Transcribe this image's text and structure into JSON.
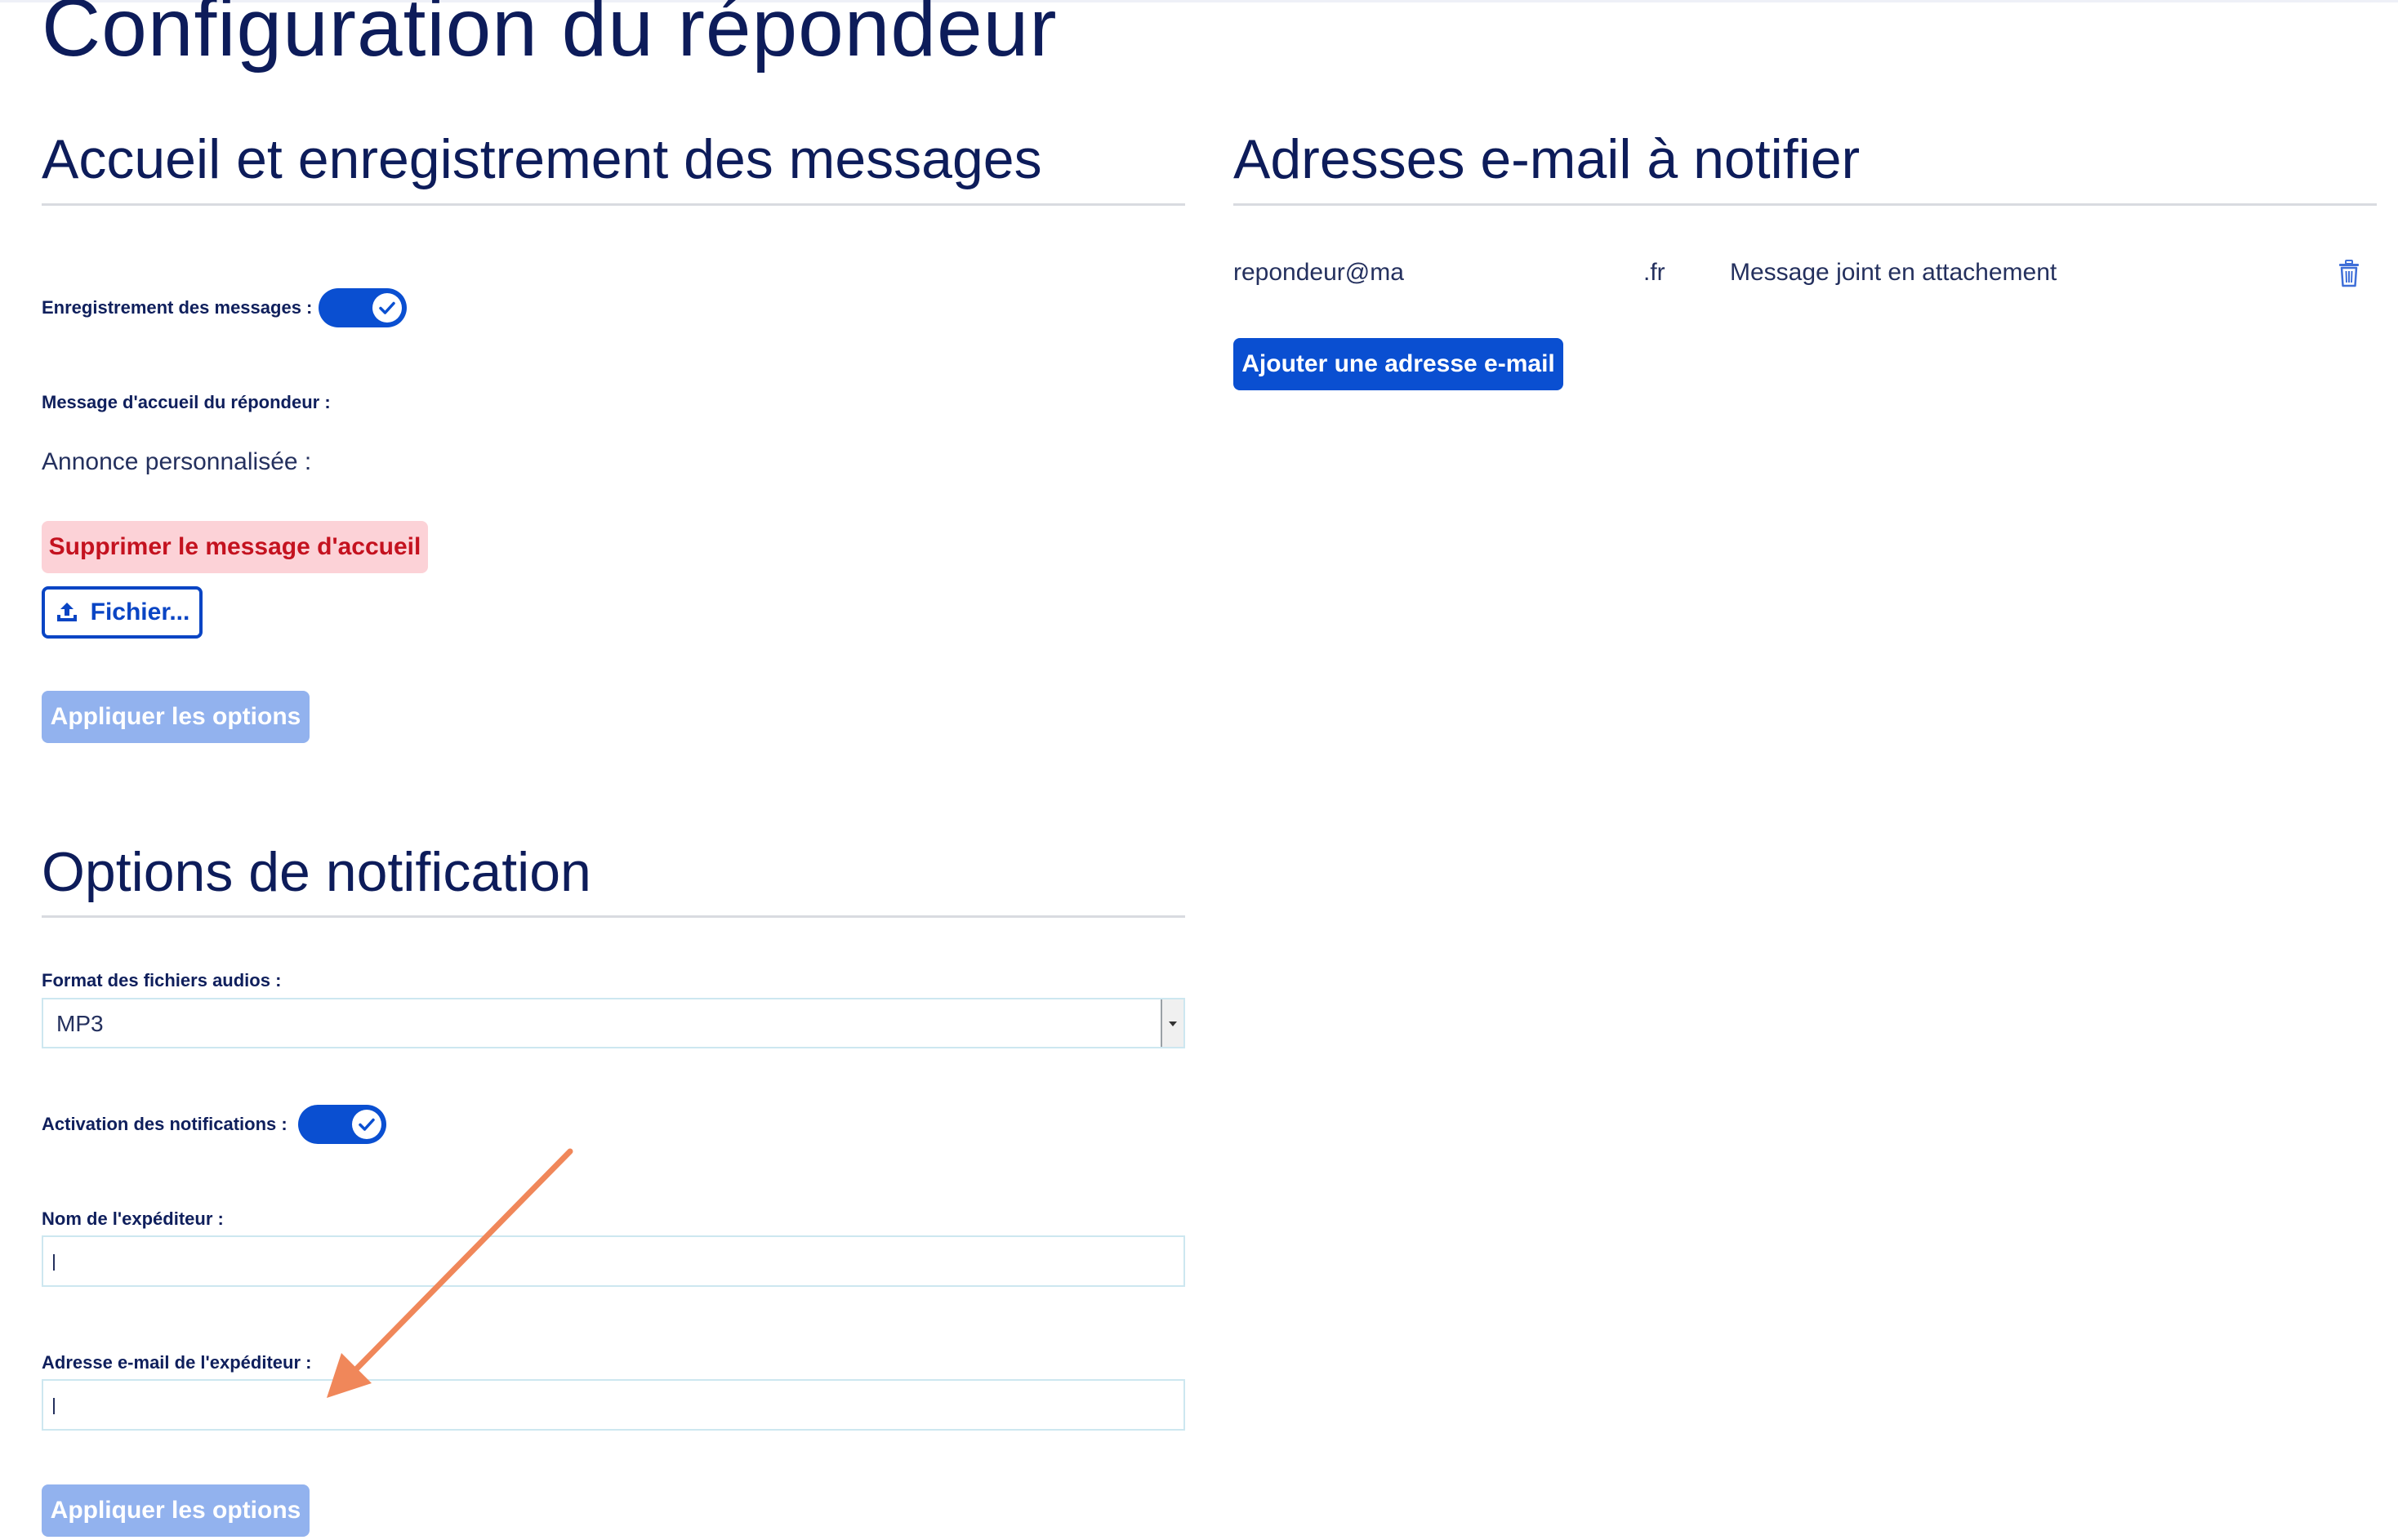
{
  "page": {
    "title": "Configuration du répondeur"
  },
  "welcome_section": {
    "title": "Accueil et enregistrement des messages",
    "recording_label": "Enregistrement des messages :",
    "recording_enabled": true,
    "welcome_message_label": "Message d'accueil du répondeur :",
    "custom_announcement_label": "Annonce personnalisée :",
    "delete_welcome_button": "Supprimer le message d'accueil",
    "file_button": "Fichier...",
    "file_icon": "upload-icon",
    "apply_button": "Appliquer les options"
  },
  "notification_section": {
    "title": "Options de notification",
    "audio_format_label": "Format des fichiers audios :",
    "audio_format_value": "MP3",
    "notifications_label": "Activation des notifications :",
    "notifications_enabled": true,
    "sender_name_label": "Nom de l'expéditeur :",
    "sender_name_value": "",
    "sender_email_label": "Adresse e-mail de l'expéditeur :",
    "sender_email_value": "",
    "apply_button": "Appliquer les options"
  },
  "email_section": {
    "title": "Adresses e-mail à notifier",
    "entries": [
      {
        "address_start": "repondeur@ma",
        "address_end": ".fr",
        "mode": "Message joint en attachement",
        "delete_icon": "trash-icon"
      }
    ],
    "add_button": "Ajouter une adresse e-mail"
  },
  "colors": {
    "primary": "#0a4fd1",
    "primary_disabled": "#92b2ee",
    "danger_text": "#c4121f",
    "danger_bg": "#fcd2d7",
    "heading": "#0d1c5a",
    "annotation_arrow": "#f0875a"
  }
}
